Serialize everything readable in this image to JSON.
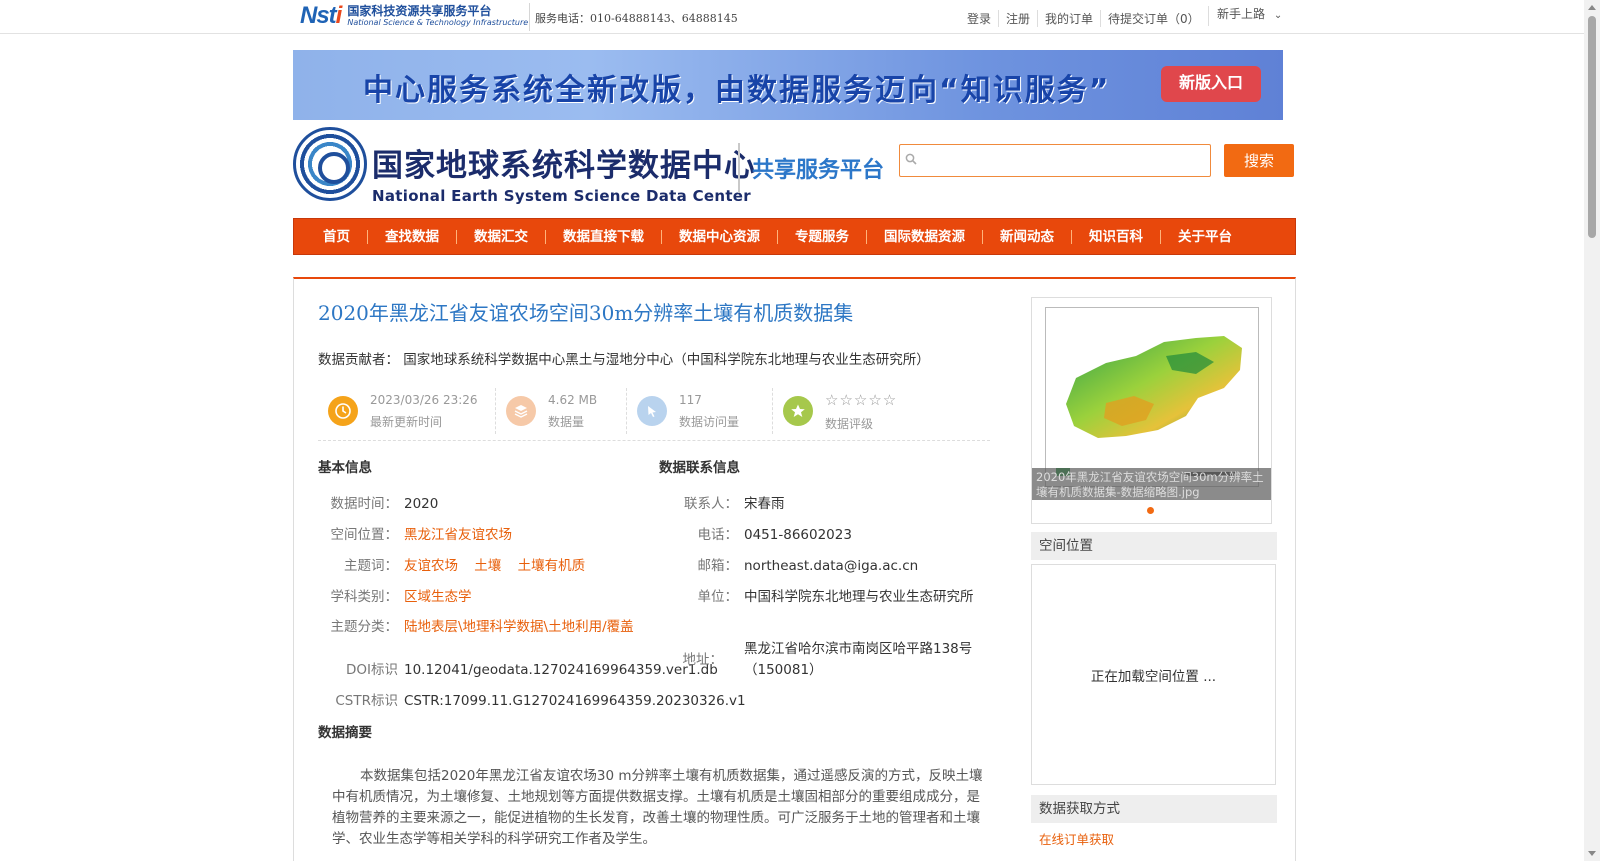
{
  "topbar": {
    "logo_mark_a": "Nst",
    "logo_mark_b": "i",
    "logo_cn": "国家科技资源共享服务平台",
    "logo_en": "National Science & Technology Infrastructure",
    "hotline": "服务电话：010-64888143、64888145",
    "links": [
      "登录",
      "注册",
      "我的订单",
      "待提交订单（0）"
    ],
    "newbie": "新手上路"
  },
  "banner": {
    "text": "中心服务系统全新改版，由数据服务迈向“知识服务”",
    "button": "新版入口"
  },
  "header": {
    "center_cn": "国家地球系统科学数据中心",
    "center_en": "National Earth System Science Data Center",
    "platform": "共享服务平台",
    "search_placeholder": "",
    "search_button": "搜索"
  },
  "nav": [
    "首页",
    "查找数据",
    "数据汇交",
    "数据直接下载",
    "数据中心资源",
    "专题服务",
    "国际数据资源",
    "新闻动态",
    "知识百科",
    "关于平台"
  ],
  "dataset": {
    "title": "2020年黑龙江省友谊农场空间30m分辨率土壤有机质数据集",
    "contributor_label": "数据贡献者：",
    "contributor": "国家地球系统科学数据中心黑土与湿地分中心（中国科学院东北地理与农业生态研究所）",
    "stats": [
      {
        "value": "2023/03/26 23:26",
        "label": "最新更新时间",
        "icon": "clock-icon",
        "color": "#f5a31a"
      },
      {
        "value": "4.62 MB",
        "label": "数据量",
        "icon": "layers-icon",
        "color": "#f6c9a8"
      },
      {
        "value": "117",
        "label": "数据访问量",
        "icon": "cursor-icon",
        "color": "#b9d3ee"
      },
      {
        "value": "☆☆☆☆☆",
        "label": "数据评级",
        "icon": "star-icon",
        "color": "#a6c84c"
      }
    ],
    "basic_title": "基本信息",
    "contact_title": "数据联系信息",
    "basic": [
      {
        "k": "数据时间：",
        "v": "2020"
      },
      {
        "k": "空间位置：",
        "links": [
          "黑龙江省友谊农场"
        ]
      },
      {
        "k": "主题词：",
        "links": [
          "友谊农场",
          "土壤",
          "土壤有机质"
        ]
      },
      {
        "k": "学科类别：",
        "links": [
          "区域生态学"
        ]
      },
      {
        "k": "主题分类：",
        "links": [
          "陆地表层\\地理科学数据\\土地利用/覆盖"
        ]
      },
      {
        "k": "DOI标识",
        "v": "10.12041/geodata.127024169964359.ver1.db"
      },
      {
        "k": "CSTR标识",
        "v": "CSTR:17099.11.G127024169964359.20230326.v1"
      }
    ],
    "contact": [
      {
        "k": "联系人：",
        "v": "宋春雨"
      },
      {
        "k": "电话：",
        "v": "0451-86602023"
      },
      {
        "k": "邮箱：",
        "v": "northeast.data@iga.ac.cn"
      },
      {
        "k": "单位：",
        "v": "中国科学院东北地理与农业生态研究所"
      },
      {
        "k": "地址：",
        "v": "黑龙江省哈尔滨市南岗区哈平路138号（150081）"
      }
    ],
    "abstract_title": "数据摘要",
    "abstract": "本数据集包括2020年黑龙江省友谊农场30 m分辨率土壤有机质数据集，通过遥感反演的方式，反映土壤中有机质情况，为土壤修复、土地规划等方面提供数据支撑。土壤有机质是土壤固相部分的重要组成成分，是植物营养的主要来源之一，能促进植物的生长发育，改善土壤的物理性质。可广泛服务于土地的管理者和土壤学、农业生态学等相关学科的科学研究工作者及学生。"
  },
  "sidebar": {
    "thumb_caption": "2020年黑龙江省友谊农场空间30m分辨率土壤有机质数据集-数据缩略图.jpg",
    "spatial_title": "空间位置",
    "spatial_loading": "正在加载空间位置 ...",
    "acquire_title": "数据获取方式",
    "acquire_link": "在线订单获取"
  }
}
